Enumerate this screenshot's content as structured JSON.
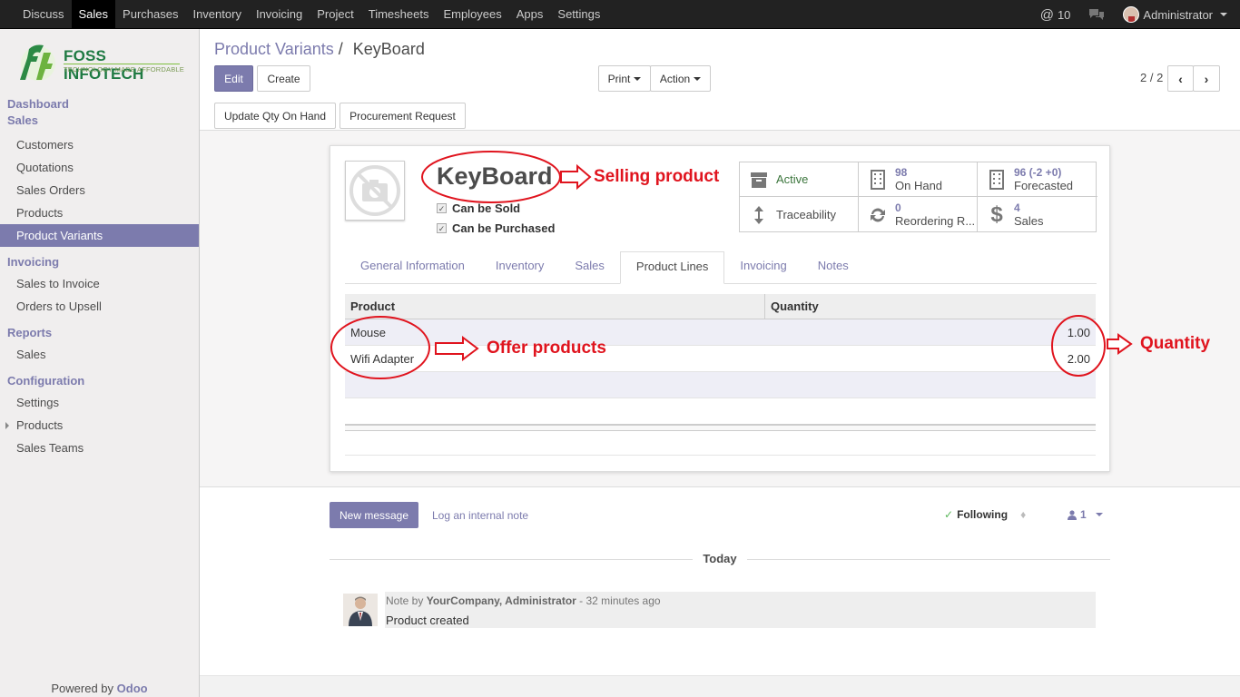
{
  "topbar": {
    "menu": [
      "Discuss",
      "Sales",
      "Purchases",
      "Inventory",
      "Invoicing",
      "Project",
      "Timesheets",
      "Employees",
      "Apps",
      "Settings"
    ],
    "mentions_count": "10",
    "user_name": "Administrator"
  },
  "logo": {
    "name": "FOSS INFOTECH",
    "tagline": "TECHNOLOGY MADE AFFORDABLE"
  },
  "sidebar": {
    "dashboard": "Dashboard",
    "sales_section": "Sales",
    "sales_items": [
      "Customers",
      "Quotations",
      "Sales Orders",
      "Products",
      "Product Variants"
    ],
    "invoicing_section": "Invoicing",
    "invoicing_items": [
      "Sales to Invoice",
      "Orders to Upsell"
    ],
    "reports_section": "Reports",
    "reports_items": [
      "Sales"
    ],
    "configuration_section": "Configuration",
    "configuration_items": [
      "Settings",
      "Products",
      "Sales Teams"
    ],
    "powered_by": "Powered by",
    "powered_brand": "Odoo"
  },
  "breadcrumb": {
    "parent": "Product Variants",
    "separator": "/",
    "current": "KeyBoard"
  },
  "toolbar": {
    "edit": "Edit",
    "create": "Create",
    "print": "Print",
    "action": "Action",
    "pager": "2 / 2"
  },
  "statusbar": {
    "update_qty": "Update Qty On Hand",
    "procurement": "Procurement Request"
  },
  "product": {
    "name": "KeyBoard",
    "can_be_sold": "Can be Sold",
    "can_be_purchased": "Can be Purchased"
  },
  "stats": {
    "active": "Active",
    "on_hand_value": "98",
    "on_hand_label": "On Hand",
    "forecast_value": "96 (-2 +0)",
    "forecast_label": "Forecasted",
    "traceability": "Traceability",
    "reordering_value": "0",
    "reordering_label": "Reordering R...",
    "sales_value": "4",
    "sales_label": "Sales"
  },
  "tabs": [
    "General Information",
    "Inventory",
    "Sales",
    "Product Lines",
    "Invoicing",
    "Notes"
  ],
  "table": {
    "headers": [
      "Product",
      "Quantity"
    ],
    "rows": [
      {
        "product": "Mouse",
        "quantity": "1.00"
      },
      {
        "product": "Wifi Adapter",
        "quantity": "2.00"
      }
    ]
  },
  "annotations": {
    "selling": "Selling product",
    "offer": "Offer products",
    "quantity": "Quantity"
  },
  "chatter": {
    "new_message": "New message",
    "log_note": "Log an internal note",
    "following": "Following",
    "followers_count": "1",
    "today": "Today",
    "note_prefix": "Note by",
    "note_author": "YourCompany, Administrator",
    "note_time": "- 32 minutes ago",
    "note_body": "Product created"
  },
  "colors": {
    "accent": "#7c7bad",
    "annotation": "#e0141e",
    "topbar": "#222222"
  }
}
